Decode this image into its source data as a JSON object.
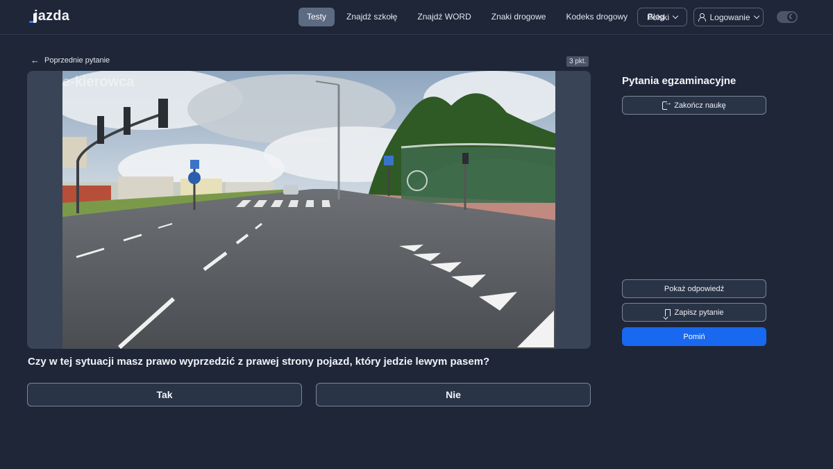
{
  "header": {
    "logo": "jazda",
    "nav": [
      {
        "label": "Testy",
        "active": true
      },
      {
        "label": "Znajdź szkołę"
      },
      {
        "label": "Znajdź WORD"
      },
      {
        "label": "Znaki drogowe"
      },
      {
        "label": "Kodeks drogowy"
      },
      {
        "label": "Blog"
      }
    ],
    "language": "Polski",
    "login": "Logowanie",
    "theme_icon": "moon-icon"
  },
  "question": {
    "back_label": "Poprzednie pytanie",
    "points": "3 pkt.",
    "watermark": "e-kierowca",
    "text": "Czy w tej sytuacji masz prawo wyprzedzić z prawej strony pojazd, który jedzie lewym pasem?",
    "answers": [
      "Tak",
      "Nie"
    ]
  },
  "sidebar": {
    "title": "Pytania egzaminacyjne",
    "finish_label": "Zakończ naukę",
    "show_answer_label": "Pokaż odpowiedź",
    "save_label": "Zapisz pytanie",
    "skip_label": "Pomiń"
  },
  "colors": {
    "background": "#1e2638",
    "primary": "#1868f0",
    "active_nav": "#5d6b82"
  }
}
